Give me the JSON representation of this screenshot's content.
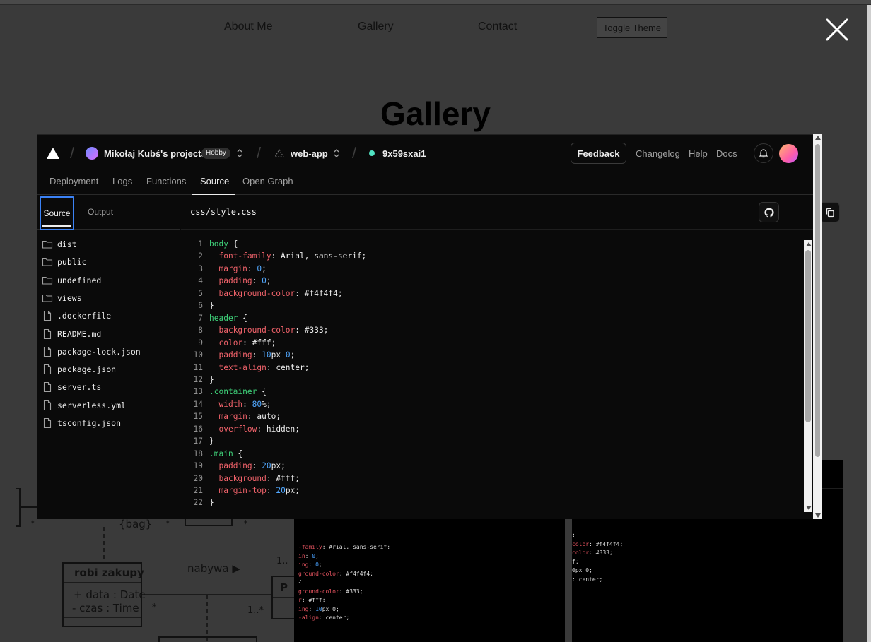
{
  "site": {
    "nav": [
      "About Me",
      "Gallery",
      "Contact"
    ],
    "theme_button": "Toggle Theme",
    "title": "Gallery"
  },
  "uml": {
    "bag_label": "{bag}",
    "class_name": "robi zakupy",
    "attr1": "+ data : Date",
    "attr2": "- czas : Time",
    "assoc_label": "nabywa ▶",
    "mult_1": "1..",
    "mult_2": "1..*",
    "star": "*",
    "box_p": "P"
  },
  "thumb1": [
    {
      "a": "-family",
      "b": ": Arial, sans-serif;"
    },
    {
      "a": "in",
      "b": ": ",
      "n": "0",
      "c": ";"
    },
    {
      "a": "ing",
      "b": ": ",
      "n": "0",
      "c": ";"
    },
    {
      "a": "ground-color",
      "b": ": #f4f4f4;"
    },
    {
      "a": "",
      "b": ""
    },
    {
      "a": "",
      "b": "{"
    },
    {
      "a": "ground-color",
      "b": ": #333;"
    },
    {
      "a": "r",
      "b": ": #fff;"
    },
    {
      "a": "ing",
      "b": ": ",
      "n": "10",
      "c": "px 0;"
    },
    {
      "a": "-align",
      "b": ": center;"
    }
  ],
  "thumb2": [
    {
      "a": "",
      "b": ";"
    },
    {
      "a": "color",
      "b": ": #f4f4f4;"
    },
    {
      "a": "",
      "b": ""
    },
    {
      "a": "",
      "b": ""
    },
    {
      "a": "color",
      "b": ": #333;"
    },
    {
      "a": "",
      "b": "f;"
    },
    {
      "a": "",
      "b": "0px 0;"
    },
    {
      "a": "",
      "b": ": center;"
    }
  ],
  "vercel": {
    "team": "Mikołaj Kubś's projects",
    "plan_badge": "Hobby",
    "project": "web-app",
    "deployment": "9x59sxai1",
    "feedback": "Feedback",
    "links": [
      "Changelog",
      "Help",
      "Docs"
    ],
    "tabs": [
      "Deployment",
      "Logs",
      "Functions",
      "Source",
      "Open Graph"
    ],
    "side_tabs": [
      "Source",
      "Output"
    ],
    "files": [
      {
        "name": "dist",
        "type": "folder"
      },
      {
        "name": "public",
        "type": "folder"
      },
      {
        "name": "undefined",
        "type": "folder"
      },
      {
        "name": "views",
        "type": "folder"
      },
      {
        "name": ".dockerfile",
        "type": "file"
      },
      {
        "name": "README.md",
        "type": "file"
      },
      {
        "name": "package-lock.json",
        "type": "file"
      },
      {
        "name": "package.json",
        "type": "file"
      },
      {
        "name": "server.ts",
        "type": "file"
      },
      {
        "name": "serverless.yml",
        "type": "file"
      },
      {
        "name": "tsconfig.json",
        "type": "file"
      }
    ],
    "file_path": "css/style.css",
    "code": [
      [
        [
          "sel",
          "body"
        ],
        [
          "txt",
          " {"
        ]
      ],
      [
        [
          "txt",
          "  "
        ],
        [
          "prop",
          "font-family"
        ],
        [
          "txt",
          ": Arial, sans-serif;"
        ]
      ],
      [
        [
          "txt",
          "  "
        ],
        [
          "prop",
          "margin"
        ],
        [
          "txt",
          ": "
        ],
        [
          "num",
          "0"
        ],
        [
          "txt",
          ";"
        ]
      ],
      [
        [
          "txt",
          "  "
        ],
        [
          "prop",
          "padding"
        ],
        [
          "txt",
          ": "
        ],
        [
          "num",
          "0"
        ],
        [
          "txt",
          ";"
        ]
      ],
      [
        [
          "txt",
          "  "
        ],
        [
          "prop",
          "background-color"
        ],
        [
          "txt",
          ": #f4f4f4;"
        ]
      ],
      [
        [
          "txt",
          "}"
        ]
      ],
      [
        [
          "sel",
          "header"
        ],
        [
          "txt",
          " {"
        ]
      ],
      [
        [
          "txt",
          "  "
        ],
        [
          "prop",
          "background-color"
        ],
        [
          "txt",
          ": #333;"
        ]
      ],
      [
        [
          "txt",
          "  "
        ],
        [
          "prop",
          "color"
        ],
        [
          "txt",
          ": #fff;"
        ]
      ],
      [
        [
          "txt",
          "  "
        ],
        [
          "prop",
          "padding"
        ],
        [
          "txt",
          ": "
        ],
        [
          "num",
          "10"
        ],
        [
          "txt",
          "px "
        ],
        [
          "num",
          "0"
        ],
        [
          "txt",
          ";"
        ]
      ],
      [
        [
          "txt",
          "  "
        ],
        [
          "prop",
          "text-align"
        ],
        [
          "txt",
          ": center;"
        ]
      ],
      [
        [
          "txt",
          "}"
        ]
      ],
      [
        [
          "sel",
          ".container"
        ],
        [
          "txt",
          " {"
        ]
      ],
      [
        [
          "txt",
          "  "
        ],
        [
          "prop",
          "width"
        ],
        [
          "txt",
          ": "
        ],
        [
          "num",
          "80"
        ],
        [
          "txt",
          "%;"
        ]
      ],
      [
        [
          "txt",
          "  "
        ],
        [
          "prop",
          "margin"
        ],
        [
          "txt",
          ": auto;"
        ]
      ],
      [
        [
          "txt",
          "  "
        ],
        [
          "prop",
          "overflow"
        ],
        [
          "txt",
          ": hidden;"
        ]
      ],
      [
        [
          "txt",
          "}"
        ]
      ],
      [
        [
          "sel",
          ".main"
        ],
        [
          "txt",
          " {"
        ]
      ],
      [
        [
          "txt",
          "  "
        ],
        [
          "prop",
          "padding"
        ],
        [
          "txt",
          ": "
        ],
        [
          "num",
          "20"
        ],
        [
          "txt",
          "px;"
        ]
      ],
      [
        [
          "txt",
          "  "
        ],
        [
          "prop",
          "background"
        ],
        [
          "txt",
          ": #fff;"
        ]
      ],
      [
        [
          "txt",
          "  "
        ],
        [
          "prop",
          "margin-top"
        ],
        [
          "txt",
          ": "
        ],
        [
          "num",
          "20"
        ],
        [
          "txt",
          "px;"
        ]
      ],
      [
        [
          "txt",
          "}"
        ]
      ]
    ]
  }
}
